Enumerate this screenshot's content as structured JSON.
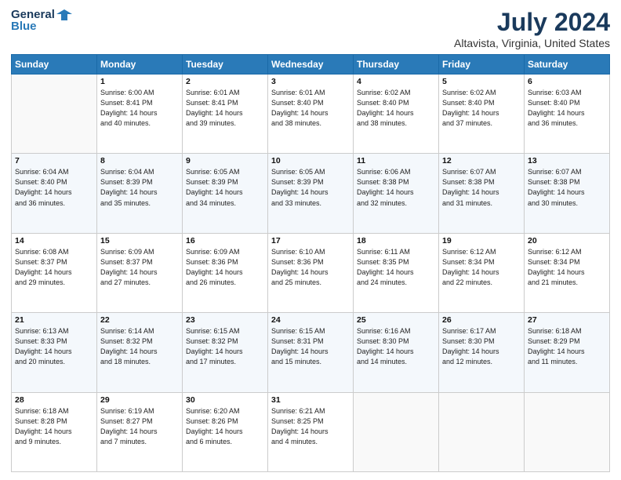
{
  "header": {
    "logo_line1": "General",
    "logo_line2": "Blue",
    "title": "July 2024",
    "subtitle": "Altavista, Virginia, United States"
  },
  "days_of_week": [
    "Sunday",
    "Monday",
    "Tuesday",
    "Wednesday",
    "Thursday",
    "Friday",
    "Saturday"
  ],
  "weeks": [
    [
      {
        "day": "",
        "info": ""
      },
      {
        "day": "1",
        "info": "Sunrise: 6:00 AM\nSunset: 8:41 PM\nDaylight: 14 hours\nand 40 minutes."
      },
      {
        "day": "2",
        "info": "Sunrise: 6:01 AM\nSunset: 8:41 PM\nDaylight: 14 hours\nand 39 minutes."
      },
      {
        "day": "3",
        "info": "Sunrise: 6:01 AM\nSunset: 8:40 PM\nDaylight: 14 hours\nand 38 minutes."
      },
      {
        "day": "4",
        "info": "Sunrise: 6:02 AM\nSunset: 8:40 PM\nDaylight: 14 hours\nand 38 minutes."
      },
      {
        "day": "5",
        "info": "Sunrise: 6:02 AM\nSunset: 8:40 PM\nDaylight: 14 hours\nand 37 minutes."
      },
      {
        "day": "6",
        "info": "Sunrise: 6:03 AM\nSunset: 8:40 PM\nDaylight: 14 hours\nand 36 minutes."
      }
    ],
    [
      {
        "day": "7",
        "info": "Sunrise: 6:04 AM\nSunset: 8:40 PM\nDaylight: 14 hours\nand 36 minutes."
      },
      {
        "day": "8",
        "info": "Sunrise: 6:04 AM\nSunset: 8:39 PM\nDaylight: 14 hours\nand 35 minutes."
      },
      {
        "day": "9",
        "info": "Sunrise: 6:05 AM\nSunset: 8:39 PM\nDaylight: 14 hours\nand 34 minutes."
      },
      {
        "day": "10",
        "info": "Sunrise: 6:05 AM\nSunset: 8:39 PM\nDaylight: 14 hours\nand 33 minutes."
      },
      {
        "day": "11",
        "info": "Sunrise: 6:06 AM\nSunset: 8:38 PM\nDaylight: 14 hours\nand 32 minutes."
      },
      {
        "day": "12",
        "info": "Sunrise: 6:07 AM\nSunset: 8:38 PM\nDaylight: 14 hours\nand 31 minutes."
      },
      {
        "day": "13",
        "info": "Sunrise: 6:07 AM\nSunset: 8:38 PM\nDaylight: 14 hours\nand 30 minutes."
      }
    ],
    [
      {
        "day": "14",
        "info": "Sunrise: 6:08 AM\nSunset: 8:37 PM\nDaylight: 14 hours\nand 29 minutes."
      },
      {
        "day": "15",
        "info": "Sunrise: 6:09 AM\nSunset: 8:37 PM\nDaylight: 14 hours\nand 27 minutes."
      },
      {
        "day": "16",
        "info": "Sunrise: 6:09 AM\nSunset: 8:36 PM\nDaylight: 14 hours\nand 26 minutes."
      },
      {
        "day": "17",
        "info": "Sunrise: 6:10 AM\nSunset: 8:36 PM\nDaylight: 14 hours\nand 25 minutes."
      },
      {
        "day": "18",
        "info": "Sunrise: 6:11 AM\nSunset: 8:35 PM\nDaylight: 14 hours\nand 24 minutes."
      },
      {
        "day": "19",
        "info": "Sunrise: 6:12 AM\nSunset: 8:34 PM\nDaylight: 14 hours\nand 22 minutes."
      },
      {
        "day": "20",
        "info": "Sunrise: 6:12 AM\nSunset: 8:34 PM\nDaylight: 14 hours\nand 21 minutes."
      }
    ],
    [
      {
        "day": "21",
        "info": "Sunrise: 6:13 AM\nSunset: 8:33 PM\nDaylight: 14 hours\nand 20 minutes."
      },
      {
        "day": "22",
        "info": "Sunrise: 6:14 AM\nSunset: 8:32 PM\nDaylight: 14 hours\nand 18 minutes."
      },
      {
        "day": "23",
        "info": "Sunrise: 6:15 AM\nSunset: 8:32 PM\nDaylight: 14 hours\nand 17 minutes."
      },
      {
        "day": "24",
        "info": "Sunrise: 6:15 AM\nSunset: 8:31 PM\nDaylight: 14 hours\nand 15 minutes."
      },
      {
        "day": "25",
        "info": "Sunrise: 6:16 AM\nSunset: 8:30 PM\nDaylight: 14 hours\nand 14 minutes."
      },
      {
        "day": "26",
        "info": "Sunrise: 6:17 AM\nSunset: 8:30 PM\nDaylight: 14 hours\nand 12 minutes."
      },
      {
        "day": "27",
        "info": "Sunrise: 6:18 AM\nSunset: 8:29 PM\nDaylight: 14 hours\nand 11 minutes."
      }
    ],
    [
      {
        "day": "28",
        "info": "Sunrise: 6:18 AM\nSunset: 8:28 PM\nDaylight: 14 hours\nand 9 minutes."
      },
      {
        "day": "29",
        "info": "Sunrise: 6:19 AM\nSunset: 8:27 PM\nDaylight: 14 hours\nand 7 minutes."
      },
      {
        "day": "30",
        "info": "Sunrise: 6:20 AM\nSunset: 8:26 PM\nDaylight: 14 hours\nand 6 minutes."
      },
      {
        "day": "31",
        "info": "Sunrise: 6:21 AM\nSunset: 8:25 PM\nDaylight: 14 hours\nand 4 minutes."
      },
      {
        "day": "",
        "info": ""
      },
      {
        "day": "",
        "info": ""
      },
      {
        "day": "",
        "info": ""
      }
    ]
  ]
}
